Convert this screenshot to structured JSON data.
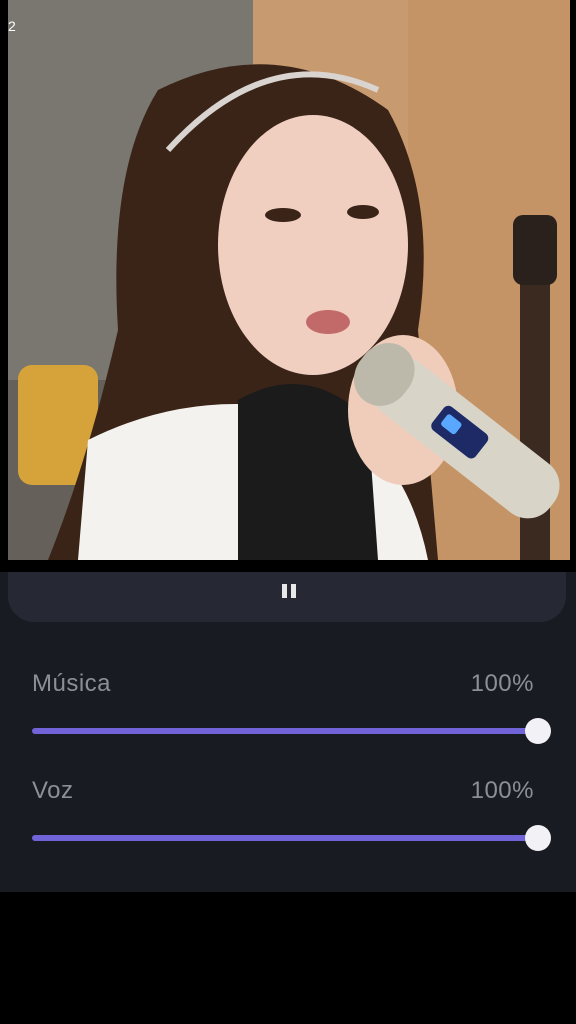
{
  "video": {
    "corner_text": "2"
  },
  "player": {
    "pause_icon": "pause-icon"
  },
  "sliders": [
    {
      "label": "Música",
      "value_text": "100%",
      "value": 1.0
    },
    {
      "label": "Voz",
      "value_text": "100%",
      "value": 1.0
    }
  ],
  "colors": {
    "panel_background": "#191b22",
    "handle_background": "#262833",
    "slider_accent": "#7064d8",
    "label_text": "#8d8f96",
    "thumb": "#f2f2f6"
  }
}
